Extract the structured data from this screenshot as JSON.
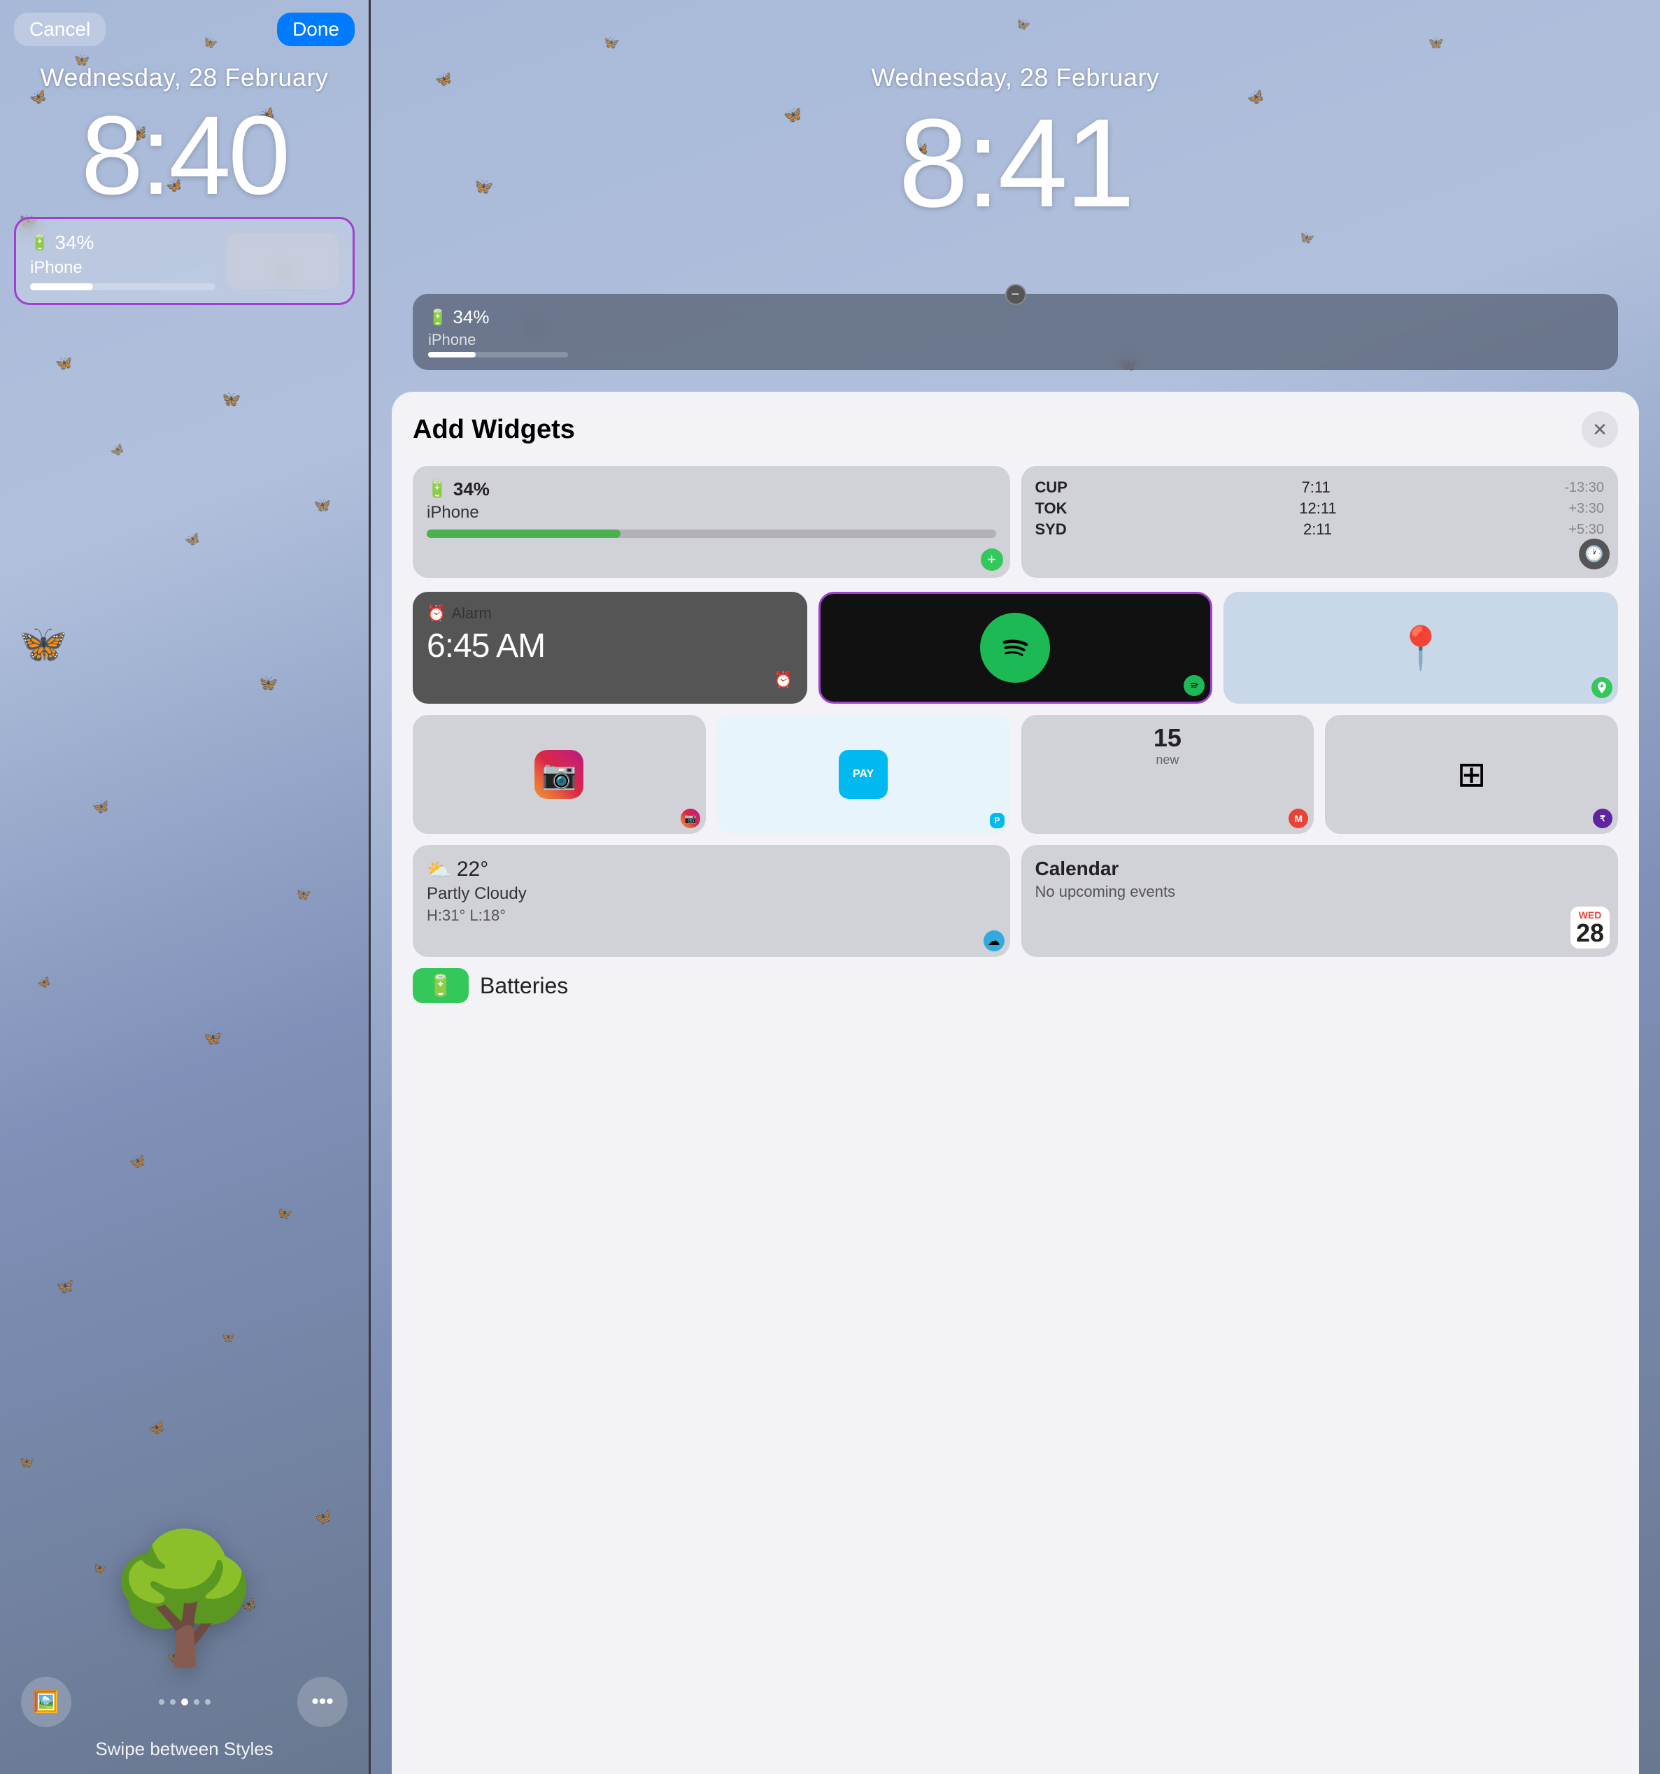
{
  "left": {
    "cancel_label": "Cancel",
    "done_label": "Done",
    "date": "Wednesday, 28 February",
    "time": "8:40",
    "battery_icon": "🔋",
    "battery_pct": "34%",
    "battery_name": "iPhone",
    "swipe_label": "Swipe between Styles",
    "dots": [
      0,
      1,
      2,
      3,
      4
    ],
    "active_dot": 2
  },
  "right": {
    "date": "Wednesday, 28 February",
    "time": "8:41",
    "battery_pct": "34%",
    "battery_name": "iPhone"
  },
  "sheet": {
    "title": "Add Widgets",
    "close_icon": "✕",
    "widgets": {
      "battery": {
        "pct": "34%",
        "name": "iPhone"
      },
      "worldclock": {
        "rows": [
          {
            "city": "CUP",
            "time": "7:11",
            "offset": "-13:30"
          },
          {
            "city": "TOK",
            "time": "12:11",
            "offset": "+3:30"
          },
          {
            "city": "SYD",
            "time": "2:11",
            "offset": "+5:30"
          }
        ]
      },
      "alarm": {
        "label": "Alarm",
        "time": "6:45 AM"
      },
      "spotify": {
        "label": "Spotify"
      },
      "maps": {
        "label": "Maps"
      },
      "instagram": {
        "label": "Instagram"
      },
      "paytm": {
        "label": "Paytm"
      },
      "gmail": {
        "count": "15",
        "count_label": "new"
      },
      "scanner": {
        "label": "Scanner"
      },
      "weather": {
        "temp": "22°",
        "desc": "Partly Cloudy",
        "high": "H:31°",
        "low": "L:18°"
      },
      "calendar": {
        "title": "Calendar",
        "sub": "No upcoming events",
        "day": "WED",
        "date": "28"
      },
      "batteries": {
        "label": "Batteries"
      }
    }
  }
}
